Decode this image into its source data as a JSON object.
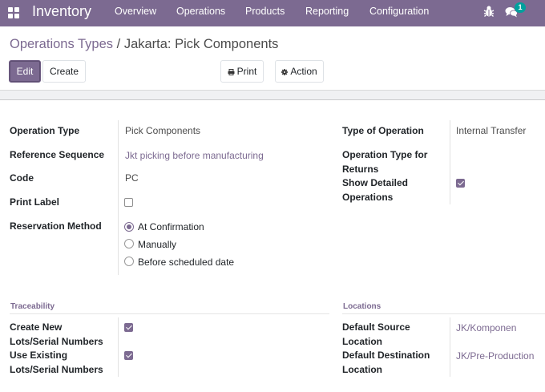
{
  "navbar": {
    "app_title": "Inventory",
    "menu": [
      "Overview",
      "Operations",
      "Products",
      "Reporting",
      "Configuration"
    ],
    "icons": [
      "apps-icon",
      "bug-icon",
      "chat-icon"
    ],
    "message_count": "1",
    "color": "#7c6a91"
  },
  "breadcrumb": {
    "parent": "Operations Types",
    "separator": "/",
    "current": "Jakarta: Pick Components"
  },
  "toolbar": {
    "edit": "Edit",
    "create": "Create",
    "print": "Print",
    "action": "Action"
  },
  "form": {
    "operation_type_label": "Operation Type",
    "operation_type_value": "Pick Components",
    "reference_sequence_label": "Reference Sequence",
    "reference_sequence_value": "Jkt picking before manufacturing",
    "code_label": "Code",
    "code_value": "PC",
    "print_label_label": "Print Label",
    "print_label_checked": false,
    "reservation_method_label": "Reservation Method",
    "reservation_options": [
      "At Confirmation",
      "Manually",
      "Before scheduled date"
    ],
    "reservation_selected": "At Confirmation",
    "type_of_operation_label": "Type of Operation",
    "type_of_operation_value": "Internal Transfer",
    "return_type_label_1": "Operation Type for",
    "return_type_label_2": "Returns",
    "show_detailed_label_1": "Show Detailed",
    "show_detailed_label_2": "Operations",
    "show_detailed_checked": true
  },
  "traceability": {
    "title": "Traceability",
    "create_new_label_1": "Create New",
    "create_new_label_2": "Lots/Serial Numbers",
    "create_new_checked": true,
    "use_existing_label_1": "Use Existing",
    "use_existing_label_2": "Lots/Serial Numbers",
    "use_existing_checked": true
  },
  "locations": {
    "title": "Locations",
    "default_source_label_1": "Default Source",
    "default_source_label_2": "Location",
    "default_source_value": "JK/Komponen",
    "default_destination_label_1": "Default Destination",
    "default_destination_label_2": "Location",
    "default_destination_value": "JK/Pre-Production"
  }
}
